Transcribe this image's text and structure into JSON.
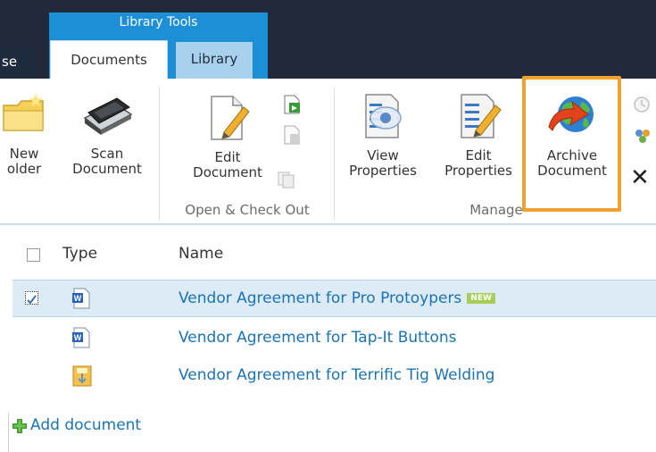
{
  "ribbon": {
    "context_group_label": "Library Tools",
    "tabs": {
      "browse": "se",
      "documents": "Documents",
      "library": "Library"
    },
    "buttons": {
      "new_folder": [
        "New",
        "older"
      ],
      "scan_document": [
        "Scan",
        "Document"
      ],
      "edit_document": [
        "Edit",
        "Document"
      ],
      "view_properties": [
        "View",
        "Properties"
      ],
      "edit_properties": [
        "Edit",
        "Properties"
      ],
      "archive_document": [
        "Archive",
        "Document"
      ]
    },
    "groups": {
      "open_check_out": "Open & Check Out",
      "manage": "Manage"
    },
    "colors": {
      "highlight": "#f0a22c",
      "context_tab": "#1c8fd6",
      "link": "#1a73b5"
    }
  },
  "list": {
    "columns": {
      "type": "Type",
      "name": "Name"
    },
    "rows": [
      {
        "name": "Vendor Agreement for Pro Protoypers",
        "icon": "word-doc-icon",
        "selected": true,
        "badge": "NEW"
      },
      {
        "name": "Vendor Agreement for Tap-It Buttons",
        "icon": "word-doc-icon",
        "selected": false
      },
      {
        "name": "Vendor Agreement for Terrific Tig Welding",
        "icon": "document-set-icon",
        "selected": false
      }
    ],
    "add_document": "Add document"
  }
}
